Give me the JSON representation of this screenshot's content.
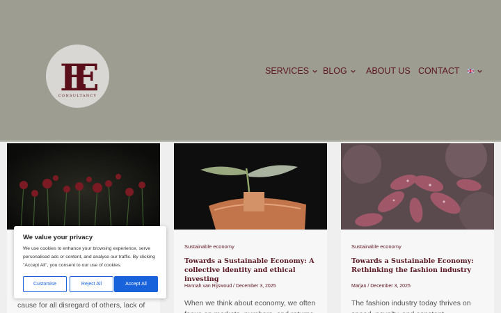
{
  "colors": {
    "header_bg": "#9d9d91",
    "brand": "#5c1622",
    "accent_blue": "#1863dc"
  },
  "logo": {
    "letters": "EE",
    "tagline": "CONSULTANCY"
  },
  "nav": {
    "items": [
      {
        "label": "SERVICES",
        "has_dropdown": true
      },
      {
        "label": "BLOG",
        "has_dropdown": true
      },
      {
        "label": "ABOUT US",
        "has_dropdown": false
      },
      {
        "label": "CONTACT",
        "has_dropdown": false
      }
    ],
    "language_icon": "uk-flag-icon"
  },
  "cards": [
    {
      "image_icon": "red-flowers-image",
      "excerpt_tail": "cause for all disregard of others, lack of"
    },
    {
      "image_icon": "plant-growing-from-banknote-image",
      "category": "Sustainable economy",
      "title": "Towards a Sustainable Economy: A collective identity and ethical investing",
      "author": "Hannah van Rijswoud",
      "date": "December 3, 2025",
      "excerpt": "When we think about economy, we often focus on markets, numbers, and returns"
    },
    {
      "image_icon": "pink-leaves-image",
      "category": "Sustainable economy",
      "title": "Towards a Sustainable Economy: Rethinking the fashion industry",
      "author": "Marjan",
      "date": "December 3, 2025",
      "excerpt": "The fashion industry today thrives on speed, novelty, and constant"
    }
  ],
  "cookie_banner": {
    "title": "We value your privacy",
    "text": "We use cookies to enhance your browsing experience, serve personalised ads or content, and analyse our traffic. By clicking \"Accept All\", you consent to our use of cookies.",
    "customise_label": "Customise",
    "reject_label": "Reject All",
    "accept_label": "Accept All"
  }
}
